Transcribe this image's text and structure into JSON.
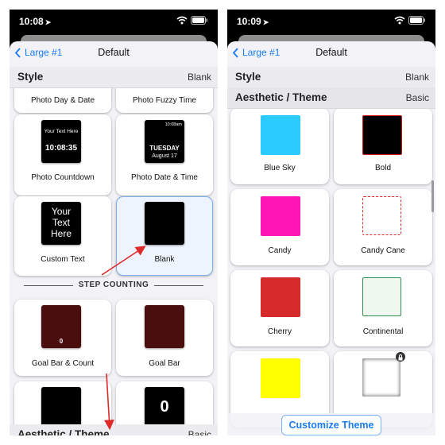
{
  "left": {
    "status": {
      "time": "10:08"
    },
    "nav": {
      "back_label": "Large #1",
      "title": "Default"
    },
    "style": {
      "label": "Style",
      "value": "Blank"
    },
    "cards": {
      "photo_day_date": "Photo Day & Date",
      "photo_fuzzy_time": "Photo Fuzzy Time",
      "photo_countdown": {
        "label": "Photo Countdown",
        "preview_top": "Your Text Here",
        "preview_time": "10:08:35"
      },
      "photo_date_time": {
        "label": "Photo Date & Time",
        "preview_time": "10:08am",
        "preview_day": "TUESDAY",
        "preview_date": "August 17"
      },
      "custom_text": {
        "label": "Custom Text",
        "preview": [
          "Your",
          "Text",
          "Here"
        ]
      },
      "blank": {
        "label": "Blank"
      },
      "goal_bar_count": {
        "label": "Goal Bar & Count",
        "preview_count": "0"
      },
      "goal_bar": {
        "label": "Goal Bar"
      },
      "partial_right": {
        "preview_count": "0"
      }
    },
    "divider": "STEP COUNTING",
    "bottom_section": {
      "label": "Aesthetic / Theme",
      "value": "Basic"
    }
  },
  "right": {
    "status": {
      "time": "10:09"
    },
    "nav": {
      "back_label": "Large #1",
      "title": "Default"
    },
    "style": {
      "label": "Style",
      "value": "Blank"
    },
    "theme": {
      "label": "Aesthetic / Theme",
      "value": "Basic"
    },
    "themes": [
      {
        "label": "Blue Sky",
        "color": "#2ccbff"
      },
      {
        "label": "Bold",
        "color": "#000000",
        "border": "#cc1a1a"
      },
      {
        "label": "Candy",
        "color": "#ff14b4"
      },
      {
        "label": "Candy Cane",
        "color": "#ffffff",
        "border": "#e02a2a"
      },
      {
        "label": "Cherry",
        "color": "#d42a2a"
      },
      {
        "label": "Continental",
        "color": "#eef8ee",
        "border": "#3a8a56"
      },
      {
        "label": "",
        "color": "#ffff00"
      },
      {
        "label": "",
        "color": "#ffffff"
      }
    ],
    "customize_button": "Customize Theme"
  },
  "colors": {
    "accent": "#1a7cf2",
    "annotation_arrow": "#e02a2a"
  },
  "icons": [
    "location-arrow-icon",
    "wifi-icon",
    "battery-icon",
    "chevron-left-icon",
    "lock-icon"
  ]
}
